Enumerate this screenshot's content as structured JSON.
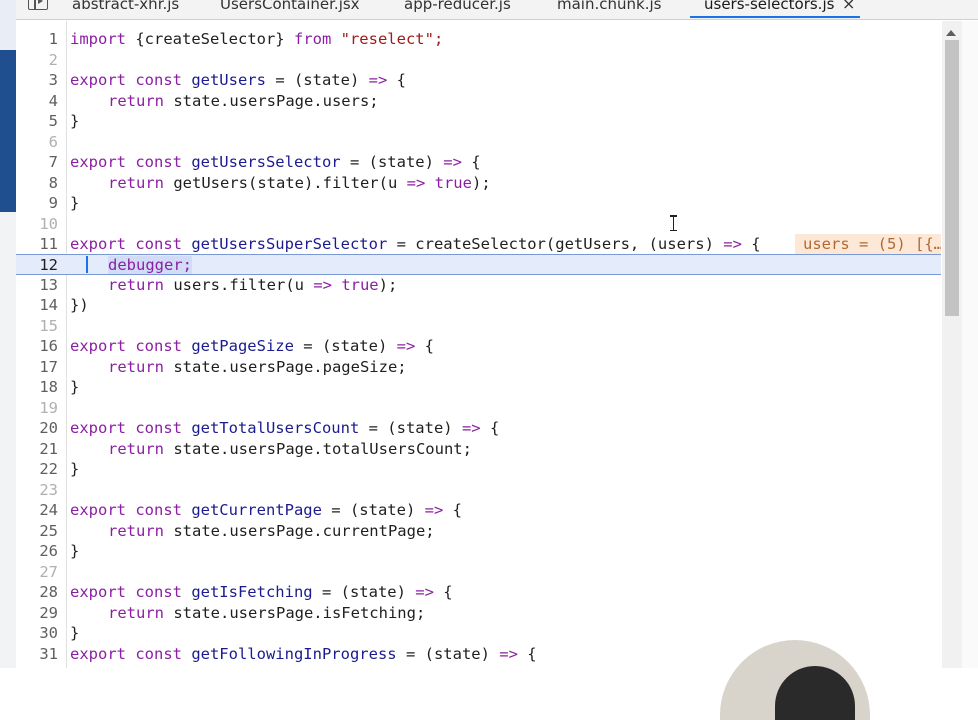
{
  "tabs": [
    {
      "label": "abstract-xhr.js",
      "active": false
    },
    {
      "label": "UsersContainer.jsx",
      "active": false
    },
    {
      "label": "app-reducer.js",
      "active": false
    },
    {
      "label": "main.chunk.js",
      "active": false
    },
    {
      "label": "users-selectors.js",
      "active": true
    }
  ],
  "tab_close_glyph": "×",
  "editor": {
    "current_line": 12,
    "lines": [
      {
        "n": "1"
      },
      {
        "n": "2"
      },
      {
        "n": "3"
      },
      {
        "n": "4"
      },
      {
        "n": "5"
      },
      {
        "n": "6"
      },
      {
        "n": "7"
      },
      {
        "n": "8"
      },
      {
        "n": "9"
      },
      {
        "n": "10"
      },
      {
        "n": "11"
      },
      {
        "n": "12"
      },
      {
        "n": "13"
      },
      {
        "n": "14"
      },
      {
        "n": "15"
      },
      {
        "n": "16"
      },
      {
        "n": "17"
      },
      {
        "n": "18"
      },
      {
        "n": "19"
      },
      {
        "n": "20"
      },
      {
        "n": "21"
      },
      {
        "n": "22"
      },
      {
        "n": "23"
      },
      {
        "n": "24"
      },
      {
        "n": "25"
      },
      {
        "n": "26"
      },
      {
        "n": "27"
      },
      {
        "n": "28"
      },
      {
        "n": "29"
      },
      {
        "n": "30"
      },
      {
        "n": "31"
      }
    ],
    "tokens": {
      "l1": {
        "kw1": "import",
        "t1": " {createSelector} ",
        "kw2": "from",
        "str": " \"reselect\";"
      },
      "l3": {
        "kw1": "export const",
        "fn": " getUsers",
        "t1": " = (state) ",
        "ar": "=>",
        "t2": " {"
      },
      "l4": {
        "kw": "return",
        "t": " state.usersPage.users;"
      },
      "l5": "}",
      "l7": {
        "kw1": "export const",
        "fn": " getUsersSelector",
        "t1": " = (state) ",
        "ar": "=>",
        "t2": " {"
      },
      "l8": {
        "kw": "return",
        "t1": " getUsers(state).filter(u ",
        "ar": "=>",
        "lit": " true",
        "t2": ");"
      },
      "l9": "}",
      "l11": {
        "kw1": "export const",
        "fn": " getUsersSuperSelector",
        "t1": " = createSelector(getUsers, (users) ",
        "ar": "=>",
        "t2": " {"
      },
      "l11_inline": "users = (5) [{…",
      "l12": "debugger;",
      "l13": {
        "kw": "return",
        "t1": " users.filter(u ",
        "ar": "=>",
        "lit": " true",
        "t2": ");"
      },
      "l14": "})",
      "l16": {
        "kw1": "export const",
        "fn": " getPageSize",
        "t1": " = (state) ",
        "ar": "=>",
        "t2": " {"
      },
      "l17": {
        "kw": "return",
        "t": " state.usersPage.pageSize;"
      },
      "l18": "}",
      "l20": {
        "kw1": "export const",
        "fn": " getTotalUsersCount",
        "t1": " = (state) ",
        "ar": "=>",
        "t2": " {"
      },
      "l21": {
        "kw": "return",
        "t": " state.usersPage.totalUsersCount;"
      },
      "l22": "}",
      "l24": {
        "kw1": "export const",
        "fn": " getCurrentPage",
        "t1": " = (state) ",
        "ar": "=>",
        "t2": " {"
      },
      "l25": {
        "kw": "return",
        "t": " state.usersPage.currentPage;"
      },
      "l26": "}",
      "l28": {
        "kw1": "export const",
        "fn": " getIsFetching",
        "t1": " = (state) ",
        "ar": "=>",
        "t2": " {"
      },
      "l29": {
        "kw": "return",
        "t": " state.usersPage.isFetching;"
      },
      "l30": "}",
      "l31": {
        "kw1": "export const",
        "fn": " getFollowingInProgress",
        "t1": " = (state) ",
        "ar": "=>",
        "t2": " {"
      }
    }
  },
  "colors": {
    "keyword": "#8b1fa3",
    "function": "#1b1b8f",
    "string": "#a11a1a",
    "execution_line": "#e4ebfb",
    "inline_value_bg": "#fde8d8",
    "accent": "#1a73e8"
  },
  "icons": {
    "sidebar_toggle": "sidebar-toggle-icon",
    "tab_close": "close-icon",
    "cursor": "text-cursor-icon"
  }
}
